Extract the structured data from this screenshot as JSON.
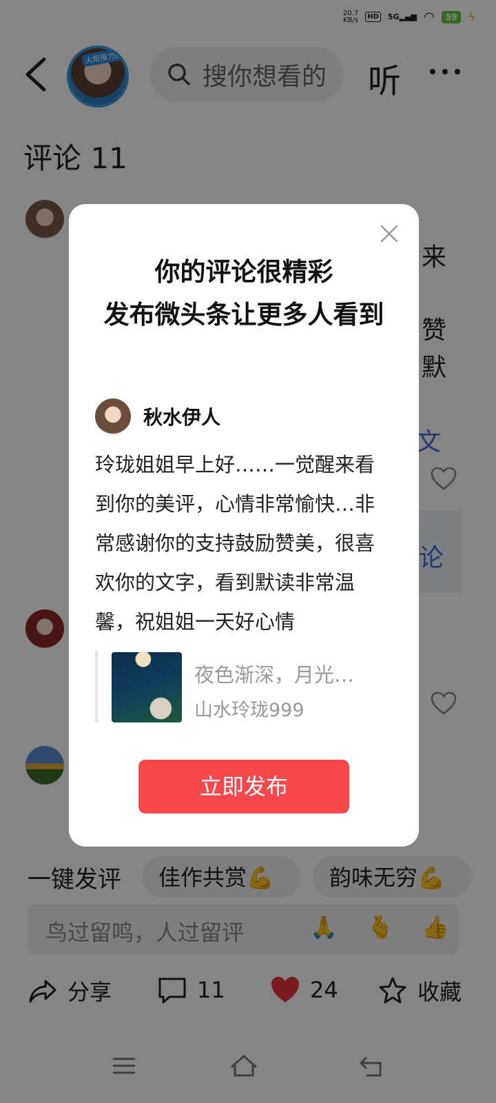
{
  "status_bar": {
    "net_speed_value": "20.7",
    "net_speed_unit": "KB/s",
    "hd": "HD",
    "network": "5G",
    "battery": "59"
  },
  "header": {
    "back_icon": "chevron-left-icon",
    "avatar_tag": "火炬接力团",
    "search_placeholder": "搜你想看的",
    "listen_label": "听",
    "more_icon": "more-horizontal-icon"
  },
  "comments": {
    "title": "评论 11",
    "peek": [
      "来",
      "赞",
      "默",
      "文",
      "论"
    ]
  },
  "quick_reply": {
    "label": "一键发评",
    "chips": [
      "佳作共赏💪",
      "韵味无穷💪"
    ]
  },
  "comment_input": {
    "placeholder": "鸟过留鸣，人过留评",
    "emojis": [
      "🙏",
      "🫰",
      "👍"
    ]
  },
  "bottom_bar": {
    "share_label": "分享",
    "comment_count": "11",
    "like_count": "24",
    "favorite_label": "收藏"
  },
  "dialog": {
    "title": "你的评论很精彩\n发布微头条让更多人看到",
    "username": "秋水伊人",
    "body": "玲珑姐姐早上好……一觉醒来看到你的美评，心情非常愉快…非常感谢你的支持鼓励赞美，很喜欢你的文字，看到默读非常温馨，祝姐姐一天好心情",
    "quote_title": "夜色渐深，月光…",
    "quote_author": "山水玲珑999",
    "publish_label": "立即发布"
  },
  "colors": {
    "accent_red": "#f6474a",
    "link_blue": "#3a6fd8",
    "overlay": "rgba(0,0,0,0.48)"
  }
}
